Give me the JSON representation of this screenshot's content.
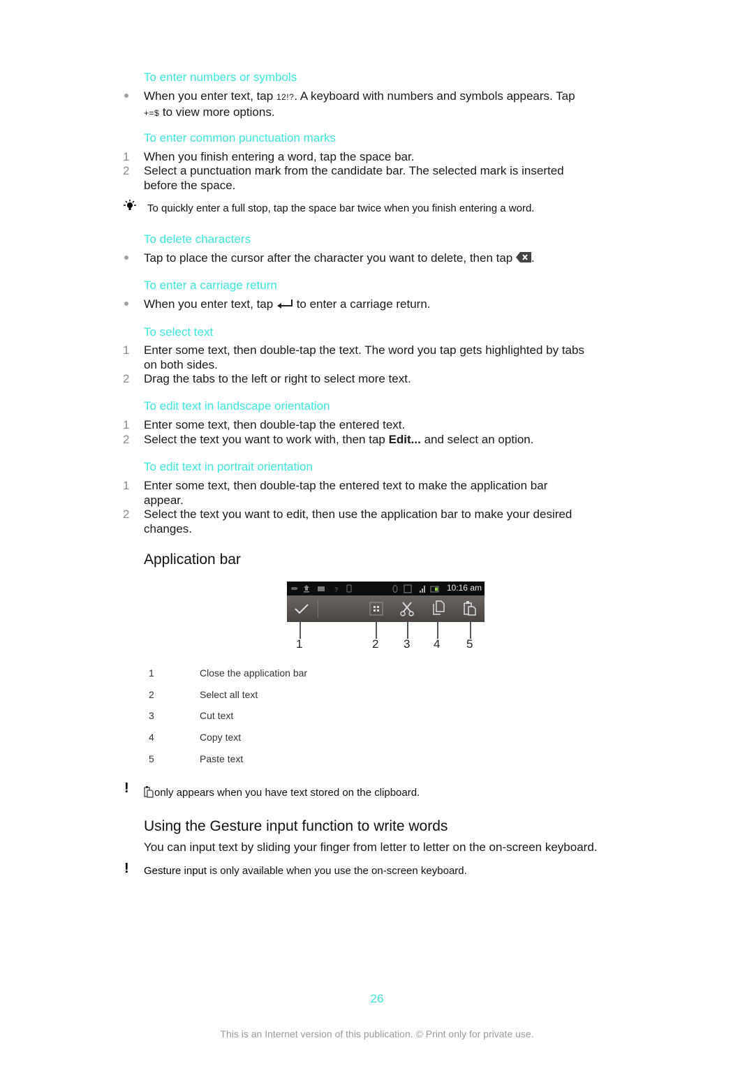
{
  "sections": {
    "numbers_symbols": {
      "heading": "To enter numbers or symbols",
      "bullet_text_a": "When you enter text, tap ",
      "glyph_a": "12!?",
      "bullet_text_b": ". A keyboard with numbers and symbols appears. Tap",
      "glyph_b": "+=$",
      "bullet_text_c": " to view more options."
    },
    "punctuation": {
      "heading": "To enter common punctuation marks",
      "steps": [
        {
          "num": "1",
          "text": "When you finish entering a word, tap the space bar."
        },
        {
          "num": "2",
          "text": "Select a punctuation mark from the candidate bar. The selected mark is inserted before the space."
        }
      ],
      "tip": "To quickly enter a full stop, tap the space bar twice when you finish entering a word."
    },
    "delete": {
      "heading": "To delete characters",
      "bullet_text": "Tap to place the cursor after the character you want to delete, then tap",
      "bullet_end": "."
    },
    "carriage_return": {
      "heading": "To enter a carriage return",
      "bullet_text_a": "When you enter text, tap",
      "bullet_text_b": "to enter a carriage return."
    },
    "select_text": {
      "heading": "To select text",
      "steps": [
        {
          "num": "1",
          "text": "Enter some text, then double-tap the text. The word you tap gets highlighted by tabs on both sides."
        },
        {
          "num": "2",
          "text": "Drag the tabs to the left or right to select more text."
        }
      ]
    },
    "landscape": {
      "heading": "To edit text in landscape orientation",
      "step1_num": "1",
      "step1": "Enter some text, then double-tap the entered text.",
      "step2_num": "2",
      "step2_a": "Select the text you want to work with, then tap ",
      "step2_bold": "Edit...",
      "step2_b": " and select an option."
    },
    "portrait": {
      "heading": "To edit text in portrait orientation",
      "steps": [
        {
          "num": "1",
          "text": "Enter some text, then double-tap the entered text to make the application bar appear."
        },
        {
          "num": "2",
          "text": "Select the text you want to edit, then use the application bar to make your desired changes."
        }
      ]
    }
  },
  "application_bar": {
    "heading": "Application bar",
    "figure": {
      "status_time": "10:16 am",
      "callouts": [
        "1",
        "2",
        "3",
        "4",
        "5"
      ]
    },
    "legend": [
      {
        "num": "1",
        "label": "Close the application bar"
      },
      {
        "num": "2",
        "label": "Select all text"
      },
      {
        "num": "3",
        "label": "Cut text"
      },
      {
        "num": "4",
        "label": "Copy text"
      },
      {
        "num": "5",
        "label": "Paste text"
      }
    ],
    "note": "only appears when you have text stored on the clipboard."
  },
  "gesture": {
    "heading": "Using the Gesture input function to write words",
    "body": "You can input text by sliding your finger from letter to letter on the on-screen keyboard.",
    "note_bold": "Gesture input",
    "note_rest": " is only available when you use the on-screen keyboard."
  },
  "footer": {
    "page_number": "26",
    "notice": "This is an Internet version of this publication. © Print only for private use."
  },
  "colors": {
    "heading_accent": "#3ee6dc",
    "body_text": "#1a1a1a",
    "footer_text": "#9a9a9a"
  }
}
